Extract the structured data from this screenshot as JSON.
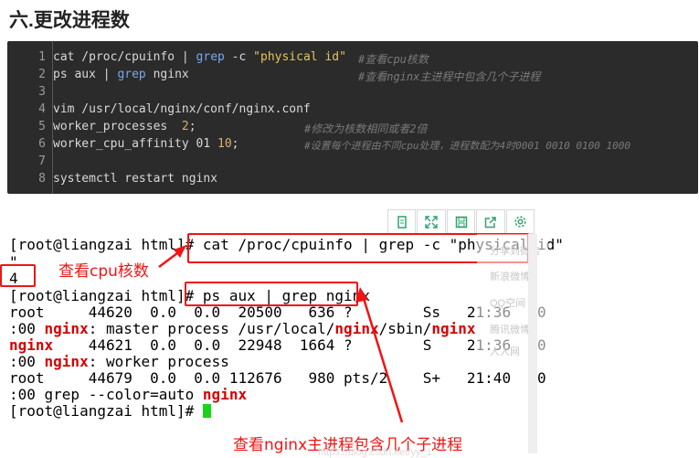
{
  "heading": "六.更改进程数",
  "code": {
    "line_numbers": [
      "1",
      "2",
      "3",
      "4",
      "5",
      "6",
      "7",
      "8"
    ],
    "l1": {
      "a": "cat /proc/cpuinfo | ",
      "b": "grep",
      "c": " -c ",
      "d": "\"physical id\"",
      "comment": "#查看cpu核数"
    },
    "l2": {
      "a": "ps aux | ",
      "b": "grep",
      "c": " nginx",
      "comment": "#查看nginx主进程中包含几个子进程"
    },
    "l4": {
      "a": "vim /usr/local/nginx/conf/nginx.conf"
    },
    "l5": {
      "a": "worker_processes  ",
      "b": "2",
      "c": ";",
      "comment": "#修改为核数相同或者2倍"
    },
    "l6": {
      "a": "worker_cpu_affinity 01 ",
      "b": "10",
      "c": ";",
      "comment": "#设置每个进程由不同cpu处理，进程数配为4时0001 0010 0100 1000"
    },
    "l8": {
      "a": "systemctl restart nginx"
    }
  },
  "terminal": {
    "t1": "[root@liangzai html]# cat /proc/cpuinfo | grep -c \"physical id\"",
    "t2": "\"",
    "t3": "4",
    "t4": "[root@liangzai html]# ps aux | grep nginx",
    "t5": "root     44620  0.0  0.0  20500   636 ?        Ss   21:36   0",
    "t6a": ":00 ",
    "t6b": "nginx",
    "t6c": ": master process /usr/local/",
    "t6d": "nginx",
    "t6e": "/sbin/",
    "t6f": "nginx",
    "t7a": "nginx",
    "t7b": "    44621  0.0  0.0  22948  1664 ?        S    21:36   0",
    "t8a": ":00 ",
    "t8b": "nginx",
    "t8c": ": worker process",
    "t9": "root     44679  0.0  0.0 112676   980 pts/2    S+   21:40   0",
    "t10a": ":00 grep --color=auto ",
    "t10b": "nginx",
    "t11": "[root@liangzai html]# "
  },
  "annotations": {
    "cpu": "查看cpu核数",
    "nginx": "查看nginx主进程包含几个子进程"
  },
  "share_items": [
    "分享到微信",
    "新浪微博",
    "QQ空间",
    "腾讯微博",
    "人人网"
  ],
  "toolbar_icons": [
    "copy-icon",
    "expand-icon",
    "save-icon",
    "share-icon",
    "settings-icon"
  ],
  "watermark": "https://blog.csdn.net/yy_1"
}
